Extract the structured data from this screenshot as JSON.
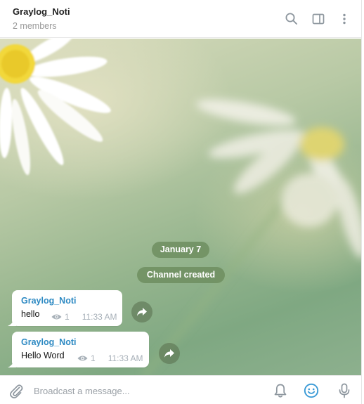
{
  "header": {
    "title": "Graylog_Noti",
    "subtitle": "2 members",
    "icons": [
      "search-icon",
      "sidebar-toggle-icon",
      "more-vertical-icon"
    ]
  },
  "service_messages": {
    "date": "January 7",
    "created": "Channel created"
  },
  "messages": [
    {
      "author": "Graylog_Noti",
      "text": "hello",
      "views": "1",
      "time": "11:33 AM"
    },
    {
      "author": "Graylog_Noti",
      "text": "Hello Word",
      "views": "1",
      "time": "11:33 AM"
    }
  ],
  "composer": {
    "placeholder": "Broadcast a message...",
    "icons": [
      "paperclip-icon",
      "bell-icon",
      "emoji-icon",
      "microphone-icon"
    ]
  },
  "colors": {
    "author": "#2e8ac3",
    "emoji_accent": "#3a9ad6",
    "icon_gray": "#8d969e"
  }
}
